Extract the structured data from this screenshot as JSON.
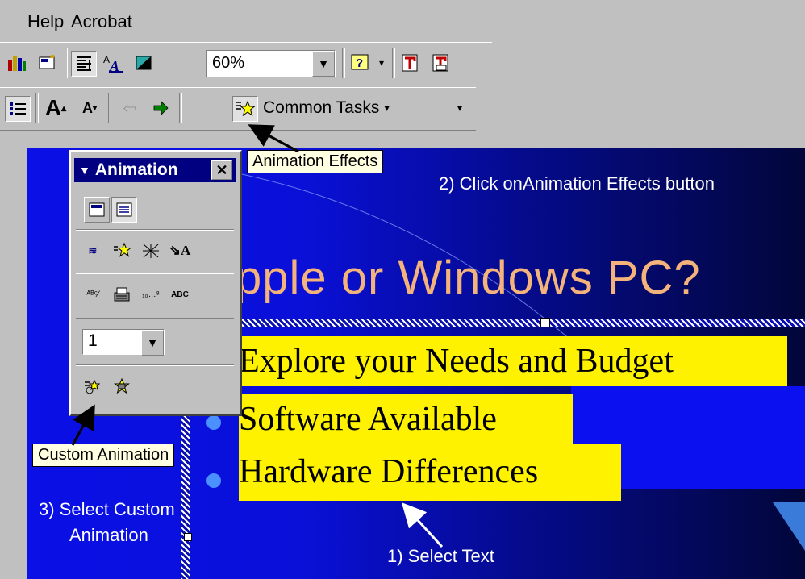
{
  "menu": {
    "help": "Help",
    "acrobat": "Acrobat"
  },
  "toolbar": {
    "zoom_value": "60%"
  },
  "common_tasks": {
    "label": "Common Tasks"
  },
  "animation_toolbar": {
    "title": "Animation",
    "count_value": "1"
  },
  "slide": {
    "title": "pple or Windows PC?",
    "bullets": [
      "Explore your Needs and Budget",
      "Software Available",
      "Hardware Differences"
    ]
  },
  "instructions": {
    "step1": "1) Select Text",
    "step2": "2) Click onAnimation Effects button",
    "step3_line1": "3) Select Custom",
    "step3_line2": "Animation"
  },
  "tooltips": {
    "animation_effects": "Animation Effects",
    "custom_animation": "Custom Animation"
  },
  "colors": {
    "slide_blue": "#0a10e6",
    "title_orange": "#f5b37c",
    "highlight_yellow": "#fff200",
    "titlebar_navy": "#000080"
  }
}
